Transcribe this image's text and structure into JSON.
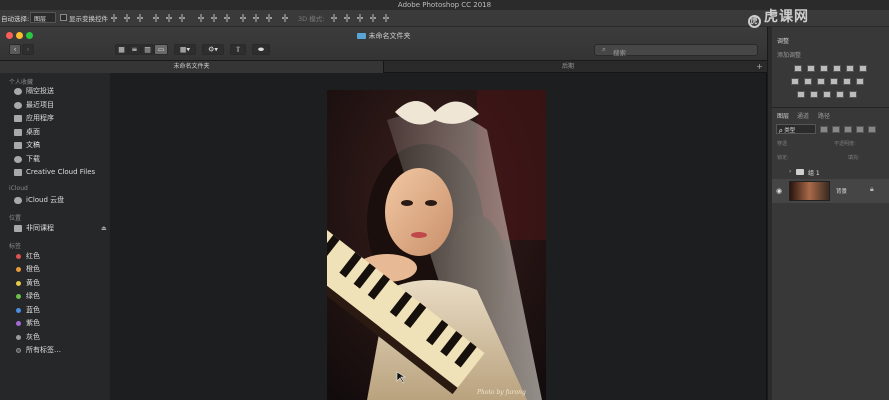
{
  "app": {
    "title": "Adobe Photoshop CC 2018"
  },
  "options_bar": {
    "auto_select_label": "自动选择:",
    "layer_select_value": "图层",
    "show_transform_label": "显示变换控件",
    "mode_3d_label": "3D 模式:"
  },
  "finder": {
    "window_title": "未命名文件夹",
    "tabs": [
      {
        "label": "未命名文件夹"
      },
      {
        "label": "后期"
      }
    ],
    "search_placeholder": "搜索",
    "sidebar": {
      "favorites_header": "个人收藏",
      "favorites": [
        {
          "label": "隔空投送",
          "icon": "airdrop-icon"
        },
        {
          "label": "最近项目",
          "icon": "clock-icon"
        },
        {
          "label": "应用程序",
          "icon": "applications-icon"
        },
        {
          "label": "桌面",
          "icon": "desktop-icon"
        },
        {
          "label": "文稿",
          "icon": "document-icon"
        },
        {
          "label": "下载",
          "icon": "download-icon"
        },
        {
          "label": "Creative Cloud Files",
          "icon": "folder-icon"
        }
      ],
      "icloud_header": "iCloud",
      "icloud": [
        {
          "label": "iCloud 云盘",
          "icon": "cloud-icon"
        }
      ],
      "locations_header": "位置",
      "locations": [
        {
          "label": "非同课程",
          "icon": "disk-icon"
        }
      ],
      "tags_header": "标签",
      "tags": [
        {
          "label": "红色",
          "color": "#e0524f"
        },
        {
          "label": "橙色",
          "color": "#e89a3c"
        },
        {
          "label": "黄色",
          "color": "#e6c84a"
        },
        {
          "label": "绿色",
          "color": "#6cc04a"
        },
        {
          "label": "蓝色",
          "color": "#4a8fe0"
        },
        {
          "label": "紫色",
          "color": "#a46ad6"
        },
        {
          "label": "灰色",
          "color": "#9a9a9a"
        },
        {
          "label": "所有标签…",
          "color": "#555555"
        }
      ]
    },
    "photo_caption": "Photo by furong"
  },
  "panels": {
    "adjustments_tab": "调整",
    "add_adjustment_label": "添加调整",
    "layers_tabs": [
      {
        "label": "图层"
      },
      {
        "label": "通道"
      },
      {
        "label": "路径"
      }
    ],
    "kind_filter": "类型",
    "blend_mode": "穿透",
    "opacity_label": "不透明度:",
    "lock_label": "锁定:",
    "fill_label": "填充:",
    "layers": [
      {
        "name": "组 1"
      },
      {
        "name": "背景"
      }
    ]
  },
  "watermark": "虎课网"
}
